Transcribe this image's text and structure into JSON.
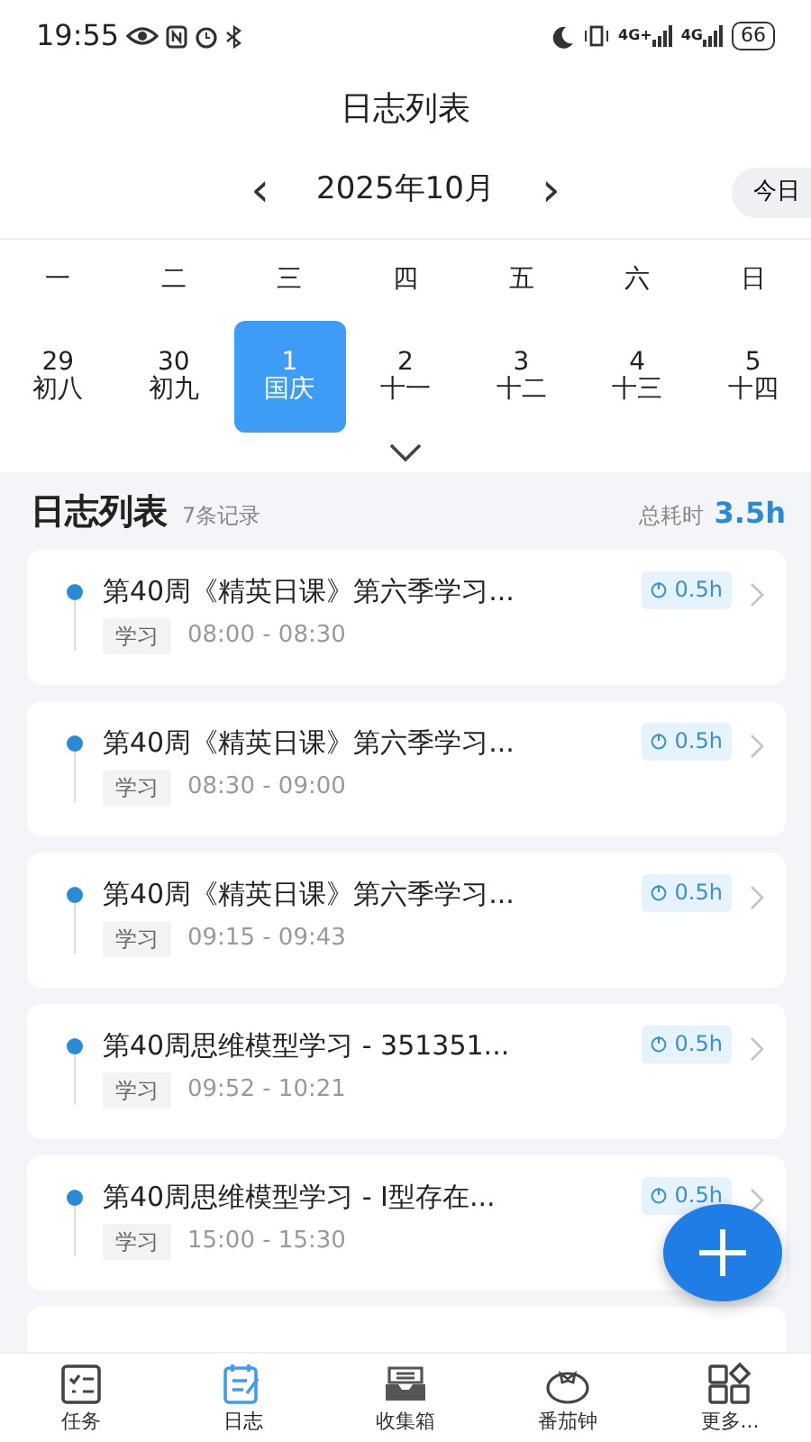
{
  "status_bar": {
    "time": "19:55",
    "networks": [
      "4G+",
      "4G"
    ],
    "battery": "66"
  },
  "header": {
    "title": "日志列表"
  },
  "month_nav": {
    "prev": "‹",
    "month": "2025年10月",
    "next": "›",
    "today_button": "今日"
  },
  "weekdays": [
    "一",
    "二",
    "三",
    "四",
    "五",
    "六",
    "日"
  ],
  "days": [
    {
      "day": "29",
      "lunar": "初八",
      "selected": false
    },
    {
      "day": "30",
      "lunar": "初九",
      "selected": false
    },
    {
      "day": "1",
      "lunar": "国庆",
      "selected": true
    },
    {
      "day": "2",
      "lunar": "十一",
      "selected": false
    },
    {
      "day": "3",
      "lunar": "十二",
      "selected": false
    },
    {
      "day": "4",
      "lunar": "十三",
      "selected": false
    },
    {
      "day": "5",
      "lunar": "十四",
      "selected": false
    }
  ],
  "list_header": {
    "title": "日志列表",
    "count": "7条记录",
    "total_label": "总耗时",
    "total": "3.5h"
  },
  "entries": [
    {
      "title": "第40周《精英日课》第六季学习...",
      "tag": "学习",
      "time": "08:00 - 08:30",
      "duration": "0.5h"
    },
    {
      "title": "第40周《精英日课》第六季学习...",
      "tag": "学习",
      "time": "08:30 - 09:00",
      "duration": "0.5h"
    },
    {
      "title": "第40周《精英日课》第六季学习...",
      "tag": "学习",
      "time": "09:15 - 09:43",
      "duration": "0.5h"
    },
    {
      "title": "第40周思维模型学习 - 351351...",
      "tag": "学习",
      "time": "09:52 - 10:21",
      "duration": "0.5h"
    },
    {
      "title": "第40周思维模型学习 - I型存在...",
      "tag": "学习",
      "time": "15:00 - 15:30",
      "duration": "0.5h"
    }
  ],
  "tabs": [
    {
      "label": "任务",
      "kind": "tasks",
      "selected": false
    },
    {
      "label": "日志",
      "kind": "log",
      "selected": true
    },
    {
      "label": "收集箱",
      "kind": "inbox",
      "selected": false
    },
    {
      "label": "番茄钟",
      "kind": "tomato",
      "selected": false
    },
    {
      "label": "更多...",
      "kind": "more",
      "selected": false
    }
  ]
}
